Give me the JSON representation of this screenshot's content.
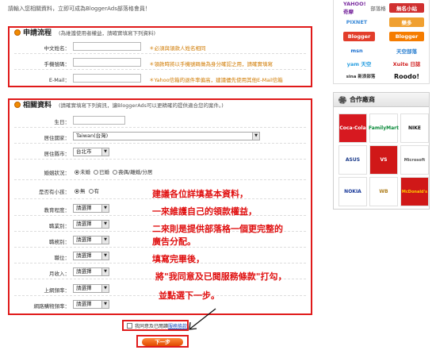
{
  "intro": "請輸入您相關資料，立即可成為BloggerAds部落格會員！",
  "section1": {
    "title": "申請流程",
    "note": "(為維護使用者權益，請確實填寫下列資料)",
    "fields": [
      {
        "label": "中文姓名：",
        "hint": "＊必須與領款人姓名相同"
      },
      {
        "label": "手機號碼：",
        "hint": "＊領款時將以手機號碼做為身分確認之用，請確實填寫"
      },
      {
        "label": "E-Mail：",
        "hint": "＊Yahoo信箱的退件率偏高，建議儘先使用其他E-Mail信箱"
      }
    ]
  },
  "section2": {
    "title": "相關資料",
    "note": "(請確實填寫下列資訊，讓BloggerAds可以更精確的提供適合您的案件。)",
    "fields": [
      {
        "label": "生日：",
        "type": "input"
      },
      {
        "label": "居住國家：",
        "type": "select",
        "value": "Taiwan(台灣)"
      },
      {
        "label": "居住縣市：",
        "type": "select",
        "value": "台北市"
      },
      {
        "label": "婚姻狀況：",
        "type": "radio",
        "options": [
          "未婚",
          "已婚",
          "喪偶/離婚/分居"
        ],
        "selected": 0
      },
      {
        "label": "是否有小孩：",
        "type": "radio",
        "options": [
          "無",
          "有"
        ],
        "selected": 0
      },
      {
        "label": "教育程度：",
        "type": "select",
        "value": "請選擇"
      },
      {
        "label": "職業別：",
        "type": "select",
        "value": "請選擇"
      },
      {
        "label": "職務別：",
        "type": "select",
        "value": "請選擇"
      },
      {
        "label": "職位：",
        "type": "select",
        "value": "請選擇"
      },
      {
        "label": "月收入：",
        "type": "select",
        "value": "請選擇"
      },
      {
        "label": "上網頻率：",
        "type": "select",
        "value": "請選擇"
      },
      {
        "label": "網路購物頻率：",
        "type": "select",
        "value": "請選擇"
      }
    ]
  },
  "annotations": [
    "建議各位詳填基本資料，",
    "一來維護自己的領款權益，",
    "二來則是提供部落格一個更完整的",
    "廣告分配。",
    "填寫完畢後，",
    "將\"我同意及已閱服務條款\"打勾，",
    "並點選下一步。"
  ],
  "agree": {
    "text": "我同意及已閱讀",
    "link": "服務條款"
  },
  "next_button": "下一步",
  "right_top_logos": [
    "YAHOO!奇摩",
    "部落格",
    "PIXNET",
    "無名小站",
    "樂多",
    "Blogger",
    "msn",
    "天空部落",
    "yam 天空",
    "Xuite 日誌",
    "sina 新浪部落",
    "Roodo!"
  ],
  "partner": {
    "title": "合作廠商",
    "logos": [
      "Coca-Cola",
      "FamilyMart",
      "NIKE",
      "ASUS",
      "VS",
      "Microsoft",
      "NOKIA",
      "WB",
      "McDonald's"
    ]
  },
  "colors": {
    "frame_red": "#e01a1a",
    "hint_orange": "#d07a00",
    "annotation_red": "#e01010",
    "button_orange": "#e04a00"
  }
}
